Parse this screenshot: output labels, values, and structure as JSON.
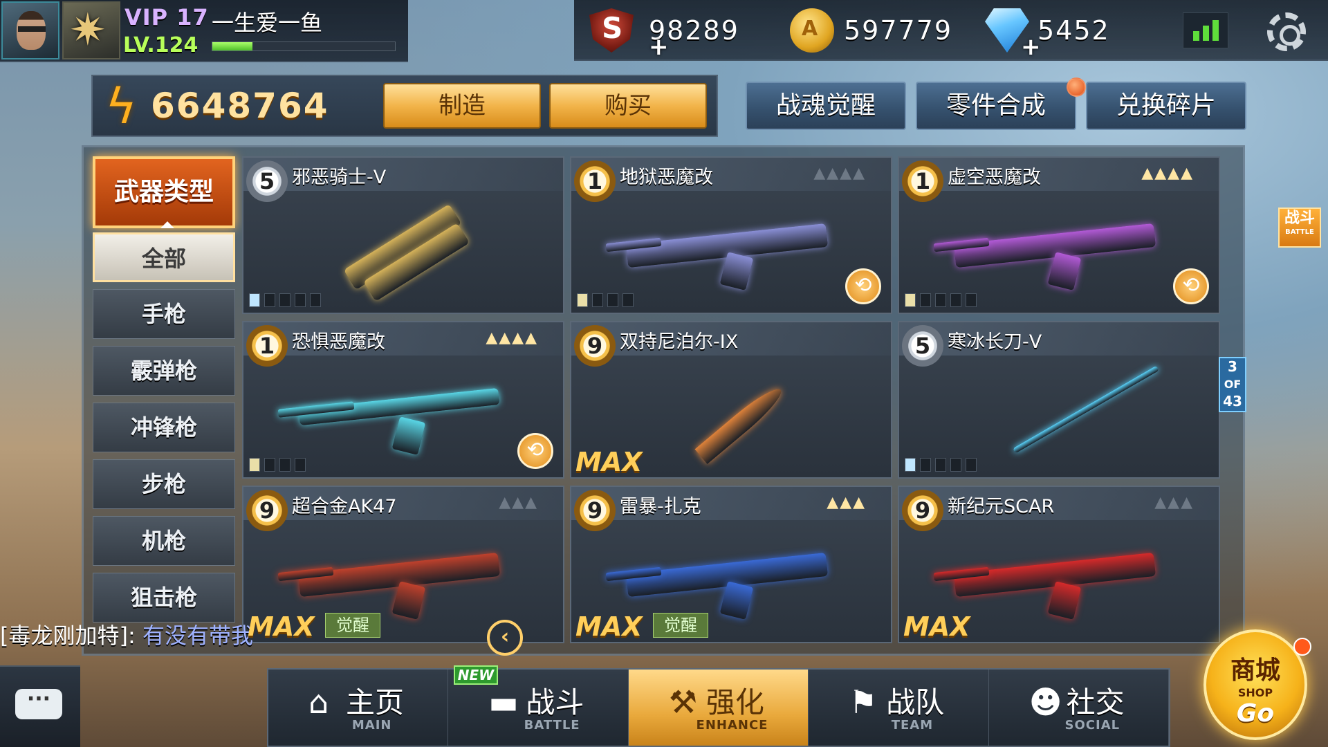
{
  "player": {
    "vip": "VIP 17",
    "name": "一生爱一鱼",
    "level": "LV.124",
    "xp_fraction": 0.22
  },
  "currencies": [
    {
      "icon": "s-shield-icon",
      "value": "98289"
    },
    {
      "icon": "gold-coin-icon",
      "value": "597779"
    },
    {
      "icon": "diamond-icon",
      "value": "5452"
    }
  ],
  "power": "6648764",
  "actions": {
    "craft": "制造",
    "buy": "购买",
    "soul_awaken": "战魂觉醒",
    "parts_synthesis": "零件合成",
    "exchange_fragments": "兑换碎片"
  },
  "sidebar": {
    "title": "武器类型",
    "categories": [
      {
        "label": "全部",
        "active": true
      },
      {
        "label": "手枪"
      },
      {
        "label": "霰弹枪"
      },
      {
        "label": "冲锋枪"
      },
      {
        "label": "步枪"
      },
      {
        "label": "机枪"
      },
      {
        "label": "狙击枪"
      }
    ]
  },
  "weapons": [
    {
      "name": "邪恶骑士-V",
      "badge": "5",
      "stars": "",
      "color": "#d6b35a"
    },
    {
      "name": "地狱恶魔改",
      "badge": "1",
      "stars": "▲▲▲▲",
      "color": "#8a8fd6"
    },
    {
      "name": "虚空恶魔改",
      "badge": "1",
      "stars": "▲▲▲▲",
      "color": "#b25ad6"
    },
    {
      "name": "恐惧恶魔改",
      "badge": "1",
      "stars": "▲▲▲▲",
      "color": "#59d6e6"
    },
    {
      "name": "双持尼泊尔-IX",
      "badge": "9",
      "stars": "",
      "color": "#e0833a",
      "max": "MAX"
    },
    {
      "name": "寒冰长刀-V",
      "badge": "5",
      "stars": "",
      "color": "#5ad6ff"
    },
    {
      "name": "超合金AK47",
      "badge": "9",
      "stars": "▲▲▲",
      "color": "#c0412c",
      "max": "MAX",
      "awaken": "觉醒"
    },
    {
      "name": "雷暴-扎克",
      "badge": "9",
      "stars": "▲▲▲",
      "color": "#3a6ad6",
      "max": "MAX",
      "awaken": "觉醒"
    },
    {
      "name": "新纪元SCAR",
      "badge": "9",
      "stars": "▲▲▲",
      "color": "#d62a2a",
      "max": "MAX"
    }
  ],
  "page_indicator": {
    "current": "3",
    "of": "OF",
    "total": "43"
  },
  "battle_tag": {
    "label": "战斗",
    "sub": "BATTLE"
  },
  "chat": {
    "sender": "[毒龙刚加特]:",
    "message": "有没有带我"
  },
  "nav": [
    {
      "label": "主页",
      "sub": "MAIN",
      "icon": "home-icon"
    },
    {
      "label": "战斗",
      "sub": "BATTLE",
      "icon": "gun-icon"
    },
    {
      "label": "强化",
      "sub": "ENHANCE",
      "icon": "hammer-icon",
      "active": true
    },
    {
      "label": "战队",
      "sub": "TEAM",
      "icon": "flag-icon"
    },
    {
      "label": "社交",
      "sub": "SOCIAL",
      "icon": "people-icon"
    }
  ],
  "new_tag": "NEW",
  "shop": {
    "label": "商城",
    "sub": "SHOP",
    "go": "Go"
  }
}
